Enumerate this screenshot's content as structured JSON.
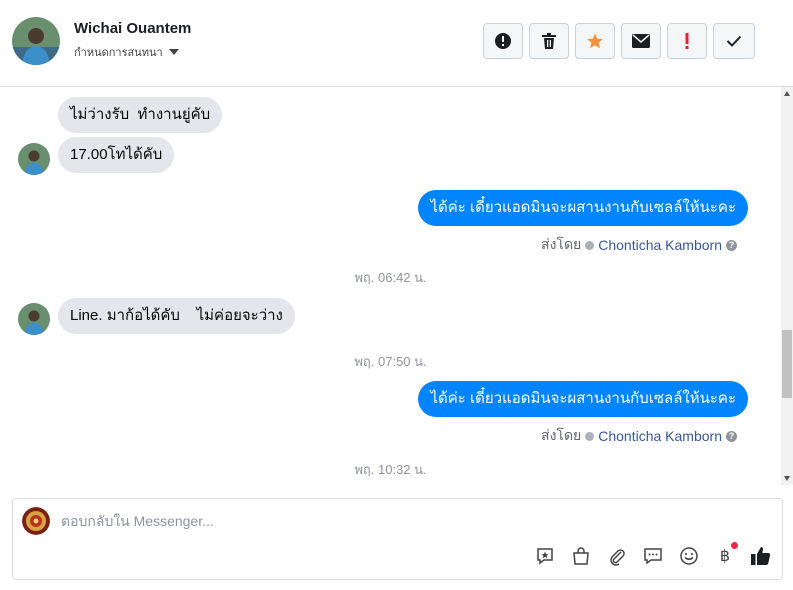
{
  "header": {
    "contact_name": "Wichai Ouantem",
    "subtitle": "กำหนดการสนทนา",
    "actions": [
      {
        "name": "report-spam-button",
        "icon": "exclamation-circle-icon"
      },
      {
        "name": "delete-button",
        "icon": "trash-icon"
      },
      {
        "name": "star-button",
        "icon": "star-icon",
        "color": "#f7923b"
      },
      {
        "name": "mark-unread-button",
        "icon": "envelope-icon"
      },
      {
        "name": "follow-up-button",
        "icon": "exclamation-icon",
        "color": "#e4242b"
      },
      {
        "name": "mark-done-button",
        "icon": "checkmark-icon"
      }
    ]
  },
  "messages": {
    "m1": "ไม่ว่างรับ  ทำงานยู่คับ",
    "m2": "17.00โทได้คับ",
    "m3": "ได้ค่ะ เดี๋ยวแอดมินจะผสานงานกับเซลล์ให้นะคะ",
    "sent1": {
      "label": "ส่งโดย",
      "name": "Chonticha Kamborn"
    },
    "t1": "พฤ. 06:42 น.",
    "m4": "Line. มาก้อได้คับ    ไม่ค่อยจะว่าง",
    "t2": "พฤ. 07:50 น.",
    "m5": "ได้ค่ะ เดี๋ยวแอดมินจะผสานงานกับเซลล์ให้นะคะ",
    "sent2": {
      "label": "ส่งโดย",
      "name": "Chonticha Kamborn"
    },
    "t3": "พฤ. 10:32 น."
  },
  "composer": {
    "placeholder": "ตอบกลับใน Messenger...",
    "tools": [
      "saved-reply-icon",
      "shop-bag-icon",
      "paperclip-icon",
      "chat-bubble-icon",
      "emoji-icon",
      "baht-icon",
      "thumbs-up-icon"
    ],
    "baht_symbol": "฿"
  },
  "colors": {
    "outgoing_bubble": "#0084ff",
    "incoming_bubble": "#e4e6eb",
    "accent_star": "#f7923b",
    "alert_red": "#e4242b"
  }
}
